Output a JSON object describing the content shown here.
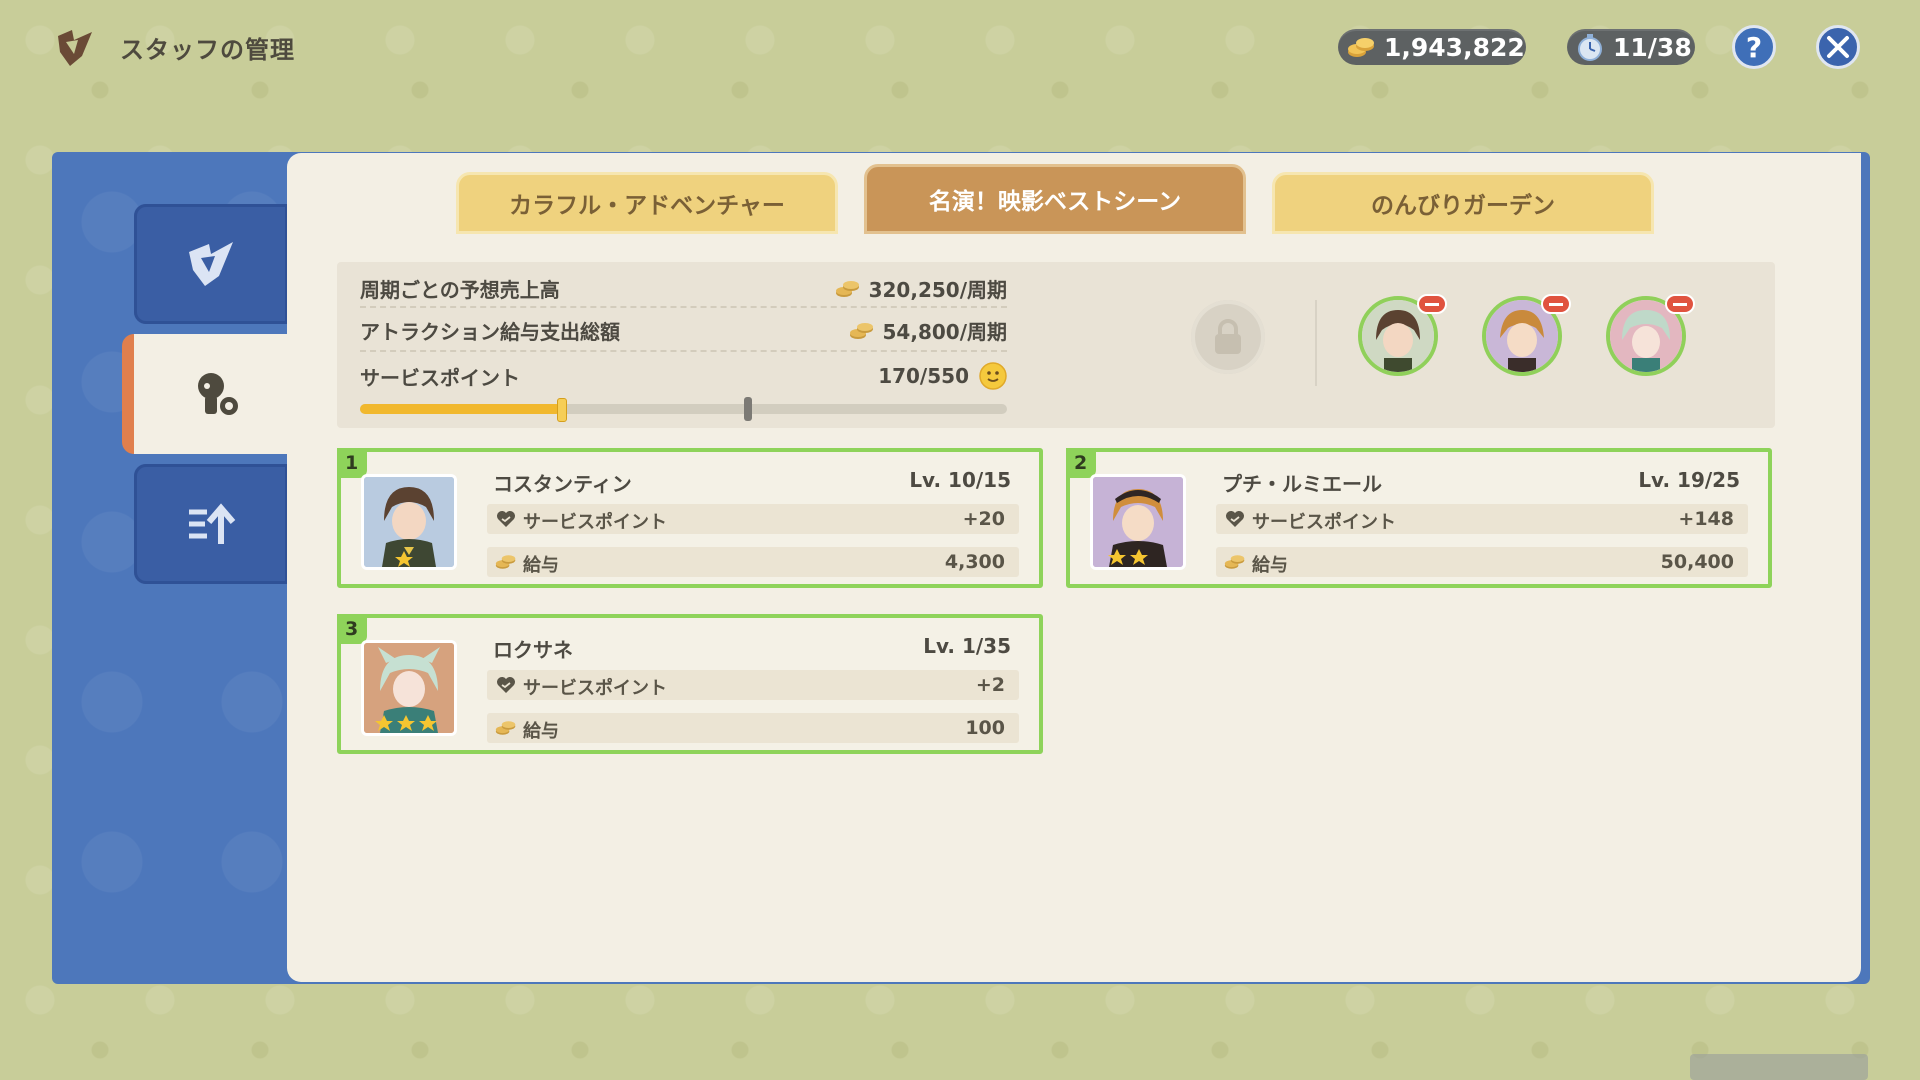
{
  "header": {
    "title": "スタッフの管理",
    "coins": "1,943,822",
    "timer": "11/38",
    "help_label": "?"
  },
  "side_tabs": [
    {
      "icon": "attraction-icon",
      "active": false
    },
    {
      "icon": "staff-icon",
      "active": true
    },
    {
      "icon": "upgrade-icon",
      "active": false
    }
  ],
  "tabs": [
    {
      "label": "カラフル・アドベンチャー",
      "active": false
    },
    {
      "label": "名演！映影ベストシーン",
      "active": true
    },
    {
      "label": "のんびりガーデン",
      "active": false
    }
  ],
  "stats": {
    "revenue_label": "周期ごとの予想売上高",
    "revenue_value": "320,250/周期",
    "salary_label": "アトラクション給与支出総額",
    "salary_value": "54,800/周期",
    "service_label": "サービスポイント",
    "service_value": "170/550",
    "service_progress": 0.31,
    "service_threshold": 0.6
  },
  "staff": [
    {
      "num": "1",
      "name": "コスタンティン",
      "level": "Lv. 10/15",
      "sp_label": "サービスポイント",
      "sp": "+20",
      "salary_label": "給与",
      "salary": "4,300",
      "stars": 1
    },
    {
      "num": "2",
      "name": "プチ・ルミエール",
      "level": "Lv. 19/25",
      "sp_label": "サービスポイント",
      "sp": "+148",
      "salary_label": "給与",
      "salary": "50,400",
      "stars": 2
    },
    {
      "num": "3",
      "name": "ロクサネ",
      "level": "Lv. 1/35",
      "sp_label": "サービスポイント",
      "sp": "+2",
      "salary_label": "給与",
      "salary": "100",
      "stars": 3
    }
  ],
  "colors": {
    "accent_green": "#8ed35a",
    "frame_blue": "#4d77bb",
    "tab_active": "#c99558",
    "tab_inactive": "#efd27e"
  }
}
